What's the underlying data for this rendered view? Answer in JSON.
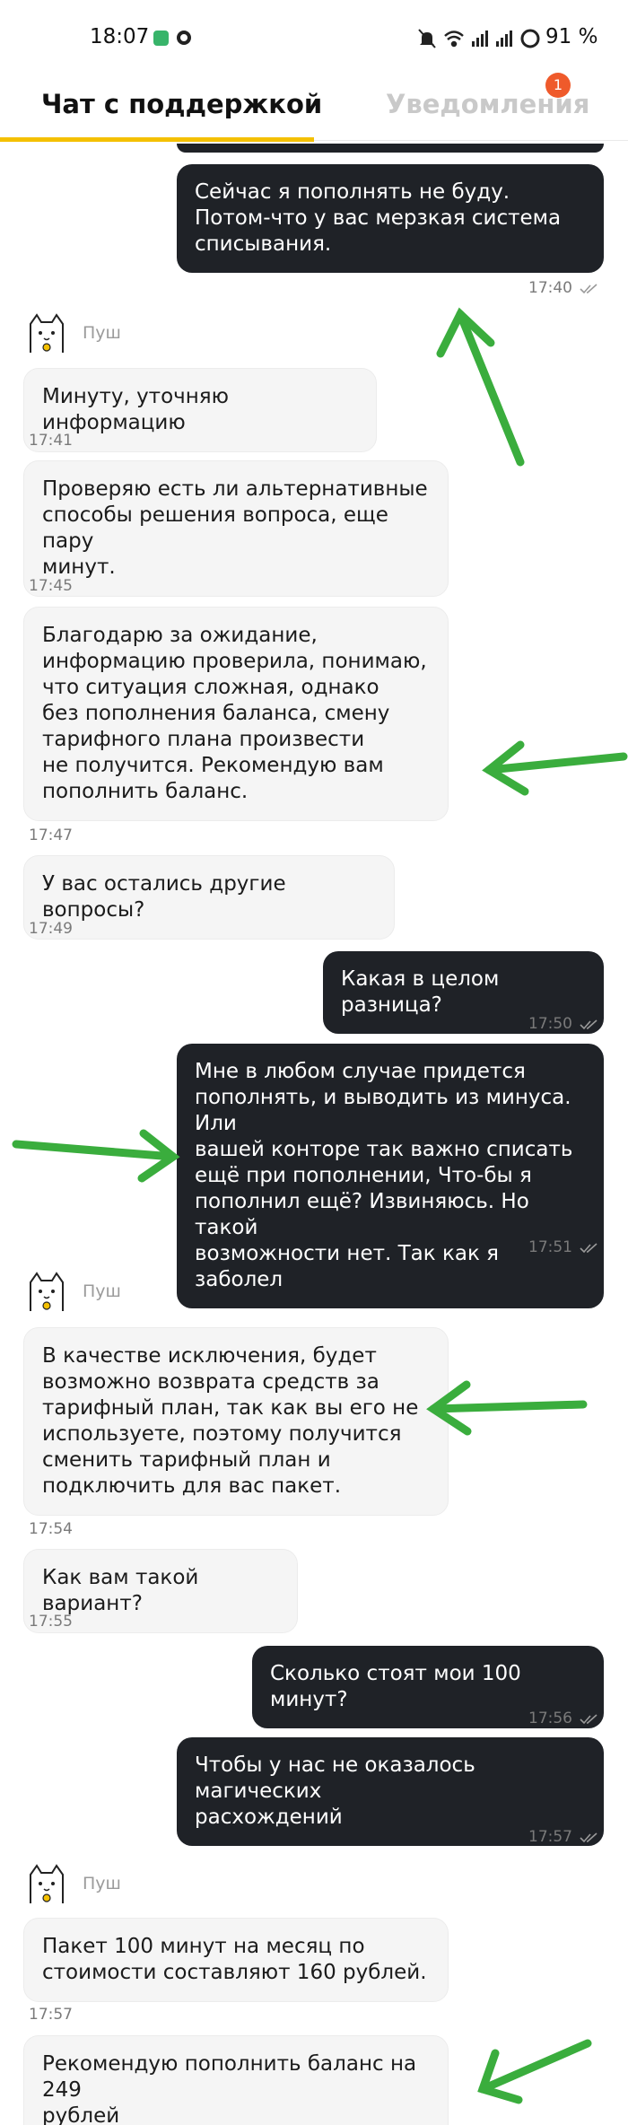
{
  "status_bar": {
    "time": "18:07",
    "battery": "91 %",
    "icons": [
      "chat-app-icon",
      "chrome-icon",
      "mute-icon",
      "wifi-icon",
      "signal-icon",
      "signal-icon",
      "battery-icon"
    ]
  },
  "tabs": {
    "chat": "Чат с поддержкой",
    "notifications": "Уведомления",
    "notifications_badge": "1"
  },
  "colors": {
    "accent": "#f4c000",
    "outgoing_bubble": "#1f2227",
    "incoming_bubble": "#f5f5f5",
    "badge": "#ef5a2b",
    "annotation_arrow": "#3aad3d"
  },
  "sender_name": "Пуш",
  "messages": [
    {
      "dir": "out",
      "text": "Сейчас я пополнять не буду.\nПотом-что у вас мерзкая система\nсписывания.",
      "time": "17:40"
    },
    {
      "dir": "in",
      "text": "Минуту, уточняю информацию",
      "time": "17:41"
    },
    {
      "dir": "in",
      "text": "Проверяю есть ли альтернативные\nспособы решения вопроса, еще пару\nминут.",
      "time": "17:45"
    },
    {
      "dir": "in",
      "text": "Благодарю за ожидание,\nинформацию проверила, понимаю,\nчто ситуация сложная, однако\nбез пополнения баланса, смену\nтарифного плана произвести\nне получится. Рекомендую вам\nпополнить баланс.",
      "time": "17:47"
    },
    {
      "dir": "in",
      "text": "У вас остались другие вопросы?",
      "time": "17:49"
    },
    {
      "dir": "out",
      "text": "Какая в целом разница?",
      "time": "17:50"
    },
    {
      "dir": "out",
      "text": "Мне в любом случае придется\nпополнять, и выводить из минуса. Или\nвашей конторе так важно списать\nещё при пополнении, Что-бы я\nпополнил ещё? Извиняюсь. Но такой\nвозможности нет. Так как я заболел",
      "time": "17:51"
    },
    {
      "dir": "in",
      "text": "В качестве исключения, будет\nвозможно возврата средств за\nтарифный план, так как вы его не\nиспользуете, поэтому получится\nсменить тарифный план и\nподключить для вас пакет.",
      "time": "17:54"
    },
    {
      "dir": "in",
      "text": "Как вам такой вариант?",
      "time": "17:55"
    },
    {
      "dir": "out",
      "text": "Сколько стоят мои 100 минут?",
      "time": "17:56"
    },
    {
      "dir": "out",
      "text": "Чтобы у нас не оказалось магических\nрасхождений",
      "time": "17:57"
    },
    {
      "dir": "in",
      "text": "Пакет 100 минут на месяц по\nстоимости составляют 160 рублей.",
      "time": "17:57"
    },
    {
      "dir": "in",
      "text": "Рекомендую пополнить баланс на 249\nрублей",
      "time": ""
    }
  ]
}
